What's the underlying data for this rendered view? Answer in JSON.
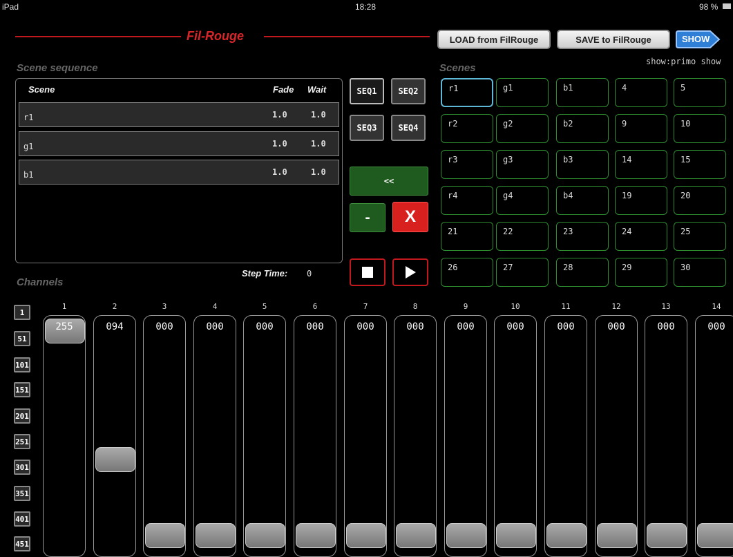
{
  "status": {
    "device": "iPad",
    "time": "18:28",
    "battery": "98 %"
  },
  "app": {
    "title": "Fil-Rouge",
    "accent": "#c0181c"
  },
  "toolbar": {
    "load_label": "LOAD from FilRouge",
    "save_label": "SAVE to FilRouge",
    "show_label": "SHOW"
  },
  "show_note": "show:primo show",
  "sequence": {
    "title": "Scene sequence",
    "columns": {
      "scene": "Scene",
      "fade": "Fade",
      "wait": "Wait"
    },
    "rows": [
      {
        "scene": "r1",
        "fade": "1.0",
        "wait": "1.0"
      },
      {
        "scene": "g1",
        "fade": "1.0",
        "wait": "1.0"
      },
      {
        "scene": "b1",
        "fade": "1.0",
        "wait": "1.0"
      }
    ],
    "step_time_label": "Step Time:",
    "step_time_value": "0"
  },
  "seq_buttons": [
    "SEQ1",
    "SEQ2",
    "SEQ3",
    "SEQ4"
  ],
  "controls": {
    "rewind_label": "<<",
    "minus_label": "-",
    "delete_label": "X"
  },
  "scenes": {
    "title": "Scenes",
    "grid": [
      [
        "r1",
        "g1",
        "b1",
        "4",
        "5"
      ],
      [
        "r2",
        "g2",
        "b2",
        "9",
        "10"
      ],
      [
        "r3",
        "g3",
        "b3",
        "14",
        "15"
      ],
      [
        "r4",
        "g4",
        "b4",
        "19",
        "20"
      ],
      [
        "21",
        "22",
        "23",
        "24",
        "25"
      ],
      [
        "26",
        "27",
        "28",
        "29",
        "30"
      ]
    ]
  },
  "channels": {
    "title": "Channels",
    "banks": [
      "1",
      "51",
      "101",
      "151",
      "201",
      "251",
      "301",
      "351",
      "401",
      "451"
    ],
    "faders": [
      {
        "num": "1",
        "value": "255",
        "level": 1.0
      },
      {
        "num": "2",
        "value": "094",
        "level": 0.37
      },
      {
        "num": "3",
        "value": "000",
        "level": 0
      },
      {
        "num": "4",
        "value": "000",
        "level": 0
      },
      {
        "num": "5",
        "value": "000",
        "level": 0
      },
      {
        "num": "6",
        "value": "000",
        "level": 0
      },
      {
        "num": "7",
        "value": "000",
        "level": 0
      },
      {
        "num": "8",
        "value": "000",
        "level": 0
      },
      {
        "num": "9",
        "value": "000",
        "level": 0
      },
      {
        "num": "10",
        "value": "000",
        "level": 0
      },
      {
        "num": "11",
        "value": "000",
        "level": 0
      },
      {
        "num": "12",
        "value": "000",
        "level": 0
      },
      {
        "num": "13",
        "value": "000",
        "level": 0
      },
      {
        "num": "14",
        "value": "000",
        "level": 0
      }
    ]
  }
}
